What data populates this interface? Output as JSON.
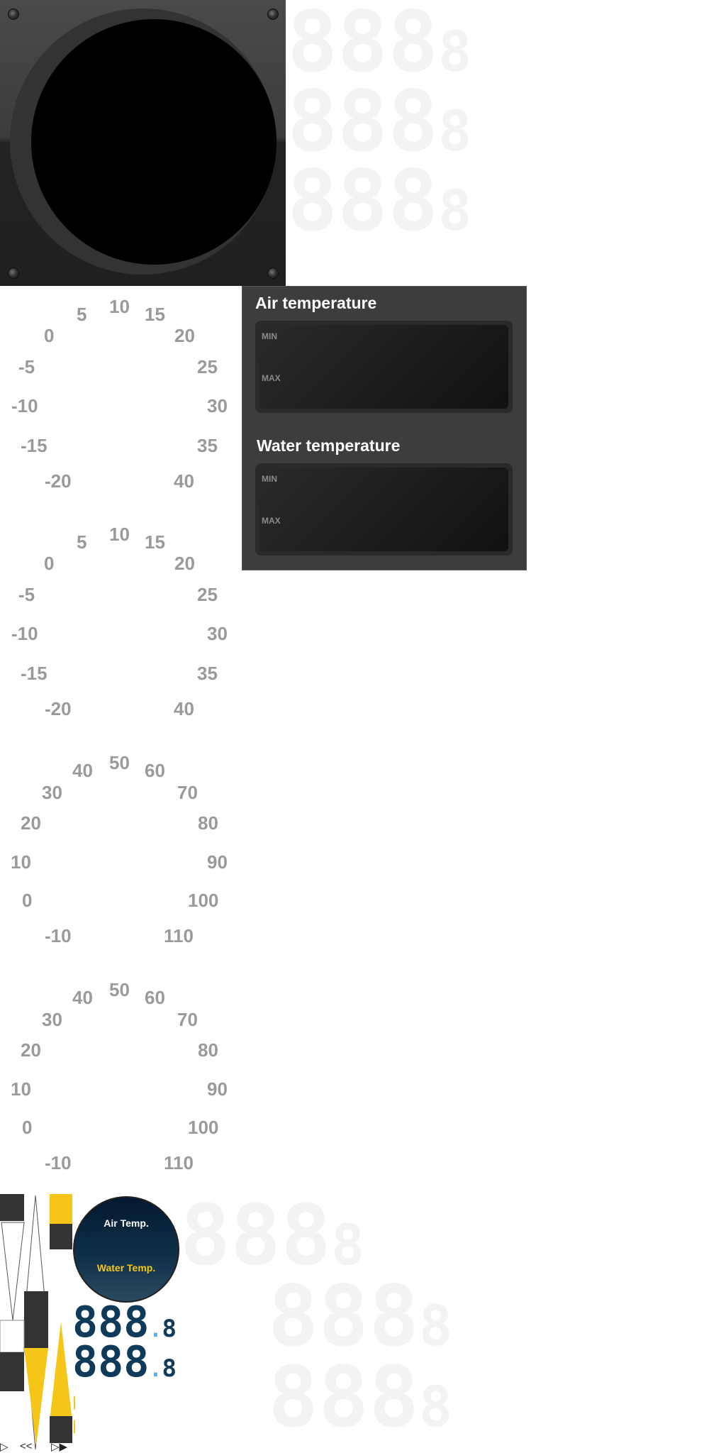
{
  "ghost_digits": {
    "big": "888",
    "small": "8"
  },
  "scale_temp": [
    "-20",
    "-15",
    "-10",
    "-5",
    "0",
    "5",
    "10",
    "15",
    "20",
    "25",
    "30",
    "35",
    "40"
  ],
  "scale_water": [
    "-10",
    "0",
    "10",
    "20",
    "30",
    "40",
    "50",
    "60",
    "70",
    "80",
    "90",
    "100",
    "110"
  ],
  "panel": {
    "air_title": "Air temperature",
    "water_title": "Water temperature",
    "min_label": "MIN",
    "max_label": "MAX"
  },
  "badge": {
    "air": "Air Temp.",
    "water": "Water Temp.",
    "air_color": "#ffffff",
    "water_color": "#f5c518"
  },
  "lcd": {
    "row1": "888",
    "row1_dec": "8",
    "row2": "888",
    "row2_dec": "8",
    "dot_color": "#4ab0ff"
  },
  "controls": {
    "prev": "<<",
    "play": "▷",
    "next": "▷▶"
  },
  "colors": {
    "accent": "#f5c518",
    "dark": "#333333"
  }
}
